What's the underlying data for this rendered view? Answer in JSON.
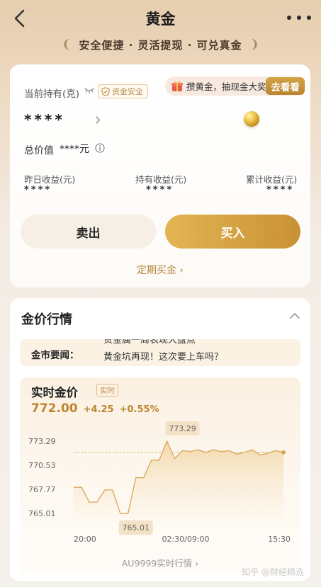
{
  "header": {
    "title": "黄金",
    "slogan": "安全便捷 · 灵活提现 · 可兑真金"
  },
  "holdings": {
    "label": "当前持有(克)",
    "badge": "资金安全",
    "promo_text": "攒黄金，抽现金大奖",
    "promo_button": "去看看",
    "amount_masked": "****",
    "total_label": "总价值",
    "total_value": "****元",
    "stats": [
      {
        "label": "昨日收益(元)",
        "value": "****"
      },
      {
        "label": "持有收益(元)",
        "value": "****"
      },
      {
        "label": "累计收益(元)",
        "value": "****"
      }
    ],
    "sell_label": "卖出",
    "buy_label": "买入",
    "regular_link": "定期买金"
  },
  "market": {
    "title": "金价行情",
    "news_label": "金市要闻：",
    "news_prev": "贵金属一周表现大盘点",
    "news_text": "黄金坑再现！这次要上车吗？",
    "realtime_title": "实时金价",
    "realtime_tag": "实时",
    "price": "772.00",
    "change_abs": "+4.25",
    "change_pct": "+0.55%",
    "au_link": "AU9999实时行情"
  },
  "chart_data": {
    "type": "line",
    "x_ticks": [
      "20:00",
      "02:30/09:00",
      "15:30"
    ],
    "y_ticks": [
      773.29,
      770.53,
      767.77,
      765.01
    ],
    "ylim": [
      765.01,
      773.29
    ],
    "reference_value": 772.0,
    "max_label": "773.29",
    "min_label": "765.01",
    "series": [
      {
        "values": [
          768.0,
          768.0,
          766.3,
          766.3,
          767.7,
          767.7,
          765.0,
          765.0,
          769.1,
          769.1,
          771.1,
          771.1,
          773.29,
          771.3,
          772.2,
          772.1,
          772.3,
          772.0,
          772.3,
          772.1,
          772.2,
          771.8,
          772.0,
          772.3,
          771.7,
          771.9,
          772.2,
          772.0
        ]
      }
    ],
    "accent_color": "#d9a755",
    "label_bg": "#f3e2c5",
    "colors": {
      "up": "#bd8633"
    }
  },
  "watermark": "知乎 @财经精选"
}
